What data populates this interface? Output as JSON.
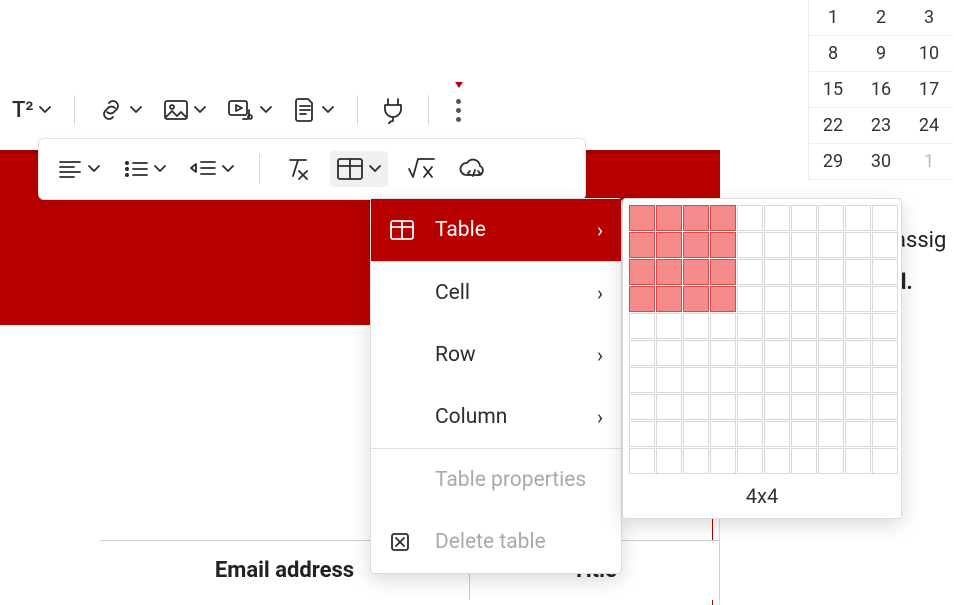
{
  "toolbar1": {
    "superscript": "T²"
  },
  "menu": {
    "table": "Table",
    "cell": "Cell",
    "row": "Row",
    "column": "Column",
    "props": "Table properties",
    "delete": "Delete table"
  },
  "grid_picker": {
    "rows": 4,
    "cols": 4,
    "max_rows": 10,
    "max_cols": 10,
    "label": "4x4"
  },
  "table_headers": {
    "email": "Email address",
    "title": "Title"
  },
  "calendar": {
    "rows": [
      [
        "1",
        "2",
        "3"
      ],
      [
        "8",
        "9",
        "10"
      ],
      [
        "15",
        "16",
        "17"
      ],
      [
        "22",
        "23",
        "24"
      ],
      [
        "29",
        "30",
        "1"
      ]
    ],
    "faded_last": "1"
  },
  "side_text": {
    "line1": "assig",
    "line2": "d."
  }
}
